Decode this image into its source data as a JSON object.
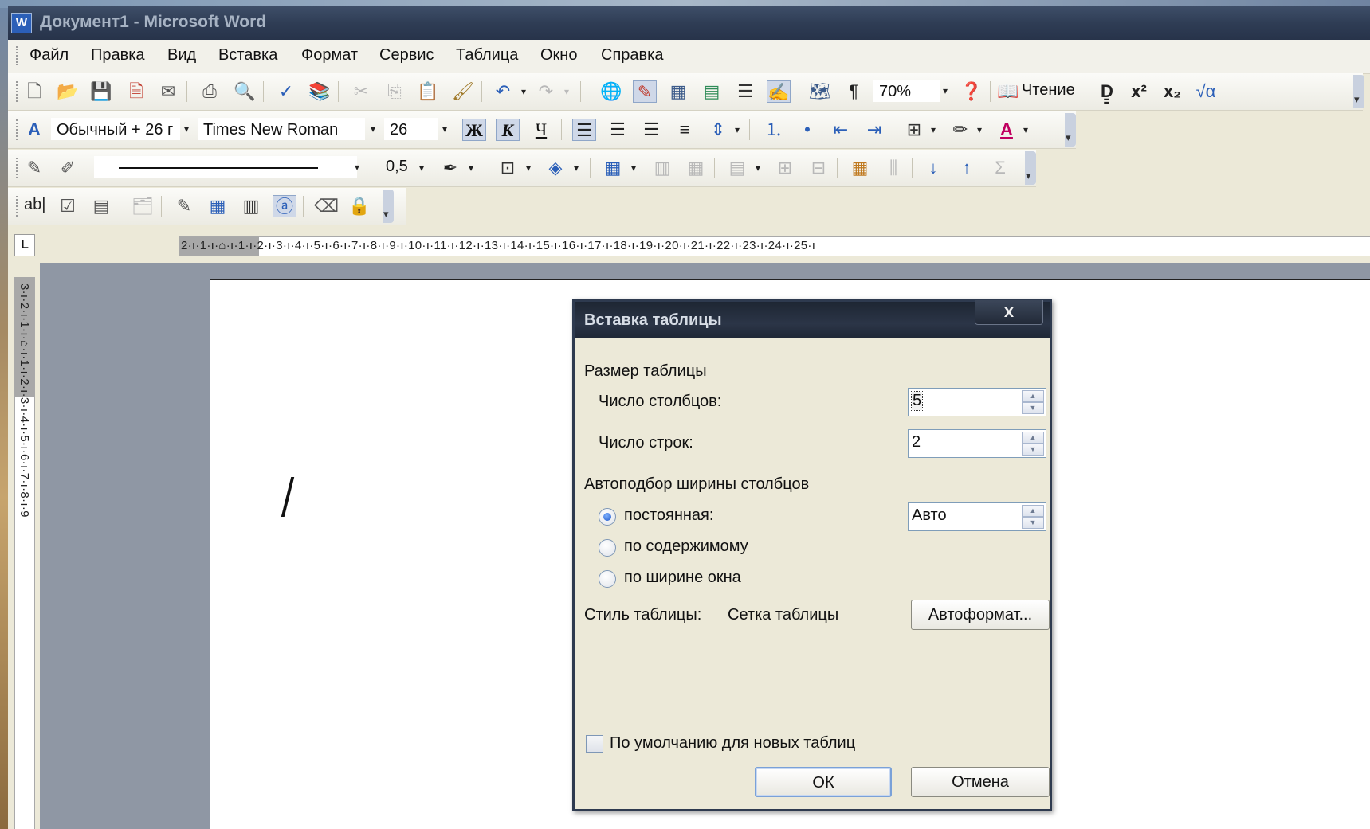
{
  "window": {
    "title": "Документ1 - Microsoft Word",
    "app_icon": "W"
  },
  "menu": [
    "Файл",
    "Правка",
    "Вид",
    "Вставка",
    "Формат",
    "Сервис",
    "Таблица",
    "Окно",
    "Справка"
  ],
  "standard_toolbar": {
    "zoom": "70%",
    "reading_label": "Чтение"
  },
  "formatting_toolbar": {
    "style": "Обычный + 26 г",
    "font": "Times New Roman",
    "size": "26",
    "bold": "Ж",
    "italic": "К",
    "underline": "Ч"
  },
  "tables_toolbar": {
    "line_weight": "0,5"
  },
  "forms_toolbar": {
    "text_field_label": "ab|"
  },
  "ruler": {
    "tab_selector": "L",
    "horizontal": "2·ı·1·ı·⌂·ı·1·ı·2·ı·3·ı·4·ı·5·ı·6·ı·7·ı·8·ı·9·ı·10·ı·11·ı·12·ı·13·ı·14·ı·15·ı·16·ı·17·ı·18·ı·19·ı·20·ı·21·ı·22·ı·23·ı·24·ı·25·ı",
    "vertical": "3·ı·2·ı·1·ı·⌂·ı·1·ı·2·ı·3·ı·4·ı·5·ı·6·ı·7·ı·8·ı·9"
  },
  "dialog": {
    "title": "Вставка таблицы",
    "close": "x",
    "size_group": "Размер таблицы",
    "columns_label": "Число столбцов:",
    "columns_value": "5",
    "rows_label": "Число строк:",
    "rows_value": "2",
    "autofit_group": "Автоподбор ширины столбцов",
    "fixed_label": "постоянная:",
    "fixed_value": "Авто",
    "content_label": "по содержимому",
    "window_label": "по ширине окна",
    "style_label": "Стиль таблицы:",
    "style_value": "Сетка таблицы",
    "autoformat_button": "Автоформат...",
    "default_checkbox": "По умолчанию для новых таблиц",
    "ok_button": "ОК",
    "cancel_button": "Отмена"
  }
}
